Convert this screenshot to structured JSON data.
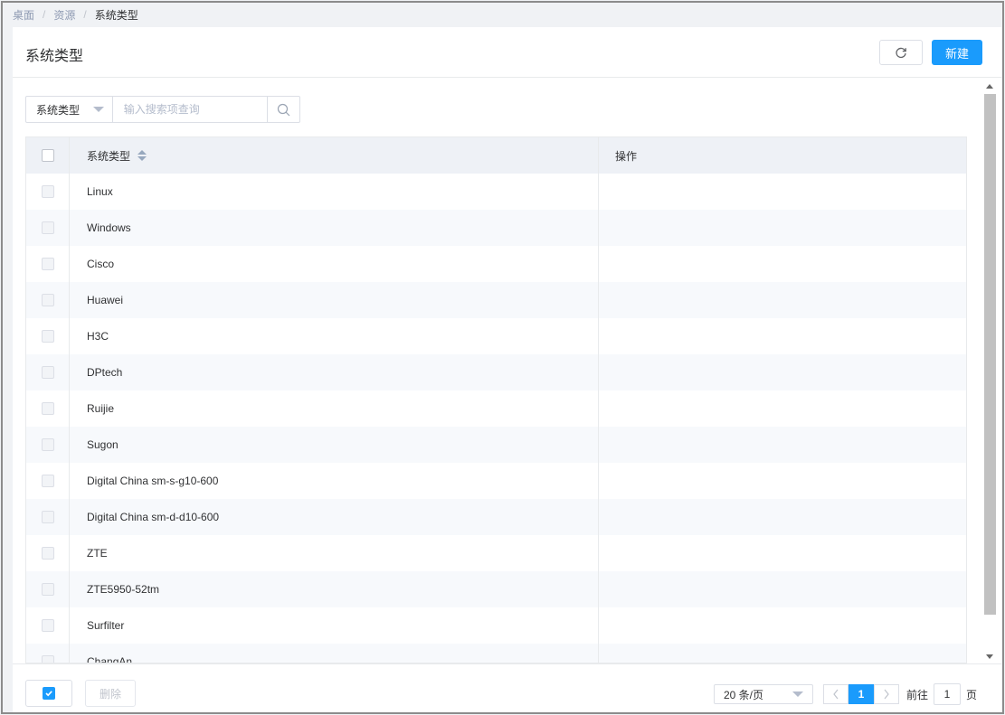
{
  "breadcrumb": {
    "items": [
      "桌面",
      "资源"
    ],
    "current": "系统类型",
    "separator": "/"
  },
  "header": {
    "title": "系统类型",
    "refresh_icon": "refresh-icon",
    "new_label": "新建"
  },
  "search": {
    "field_label": "系统类型",
    "placeholder": "输入搜索项查询",
    "value": ""
  },
  "table": {
    "columns": {
      "name": "系统类型",
      "action": "操作"
    },
    "rows": [
      {
        "name": "Linux"
      },
      {
        "name": "Windows"
      },
      {
        "name": "Cisco"
      },
      {
        "name": "Huawei"
      },
      {
        "name": "H3C"
      },
      {
        "name": "DPtech"
      },
      {
        "name": "Ruijie"
      },
      {
        "name": "Sugon"
      },
      {
        "name": "Digital China sm-s-g10-600"
      },
      {
        "name": "Digital China sm-d-d10-600"
      },
      {
        "name": "ZTE"
      },
      {
        "name": "ZTE5950-52tm"
      },
      {
        "name": "Surfilter"
      },
      {
        "name": "ChangAn"
      }
    ]
  },
  "footer": {
    "delete_label": "删除",
    "page_size": "20 条/页",
    "current_page": "1",
    "goto_prefix": "前往",
    "goto_value": "1",
    "goto_suffix": "页"
  },
  "colors": {
    "primary": "#1a9bfc",
    "header_bg": "#eef1f6",
    "stripe_bg": "#f7f9fc",
    "border": "#dcdfe6"
  }
}
